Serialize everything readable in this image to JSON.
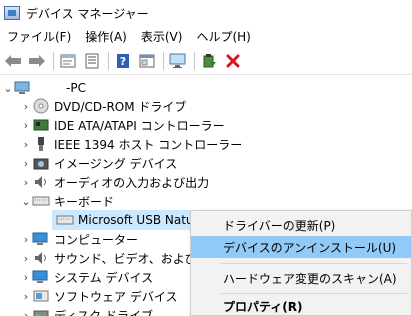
{
  "window": {
    "title": "デバイス マネージャー"
  },
  "menubar": {
    "items": [
      {
        "label": "ファイル(F)"
      },
      {
        "label": "操作(A)"
      },
      {
        "label": "表示(V)"
      },
      {
        "label": "ヘルプ(H)"
      }
    ]
  },
  "toolbar": {
    "icons": [
      "back-arrow-icon",
      "forward-arrow-icon",
      "properties-sheet-icon",
      "view-list-icon",
      "help-icon",
      "panel-icon",
      "monitor-scan-icon",
      "update-driver-icon",
      "uninstall-x-icon"
    ]
  },
  "tree": {
    "root": {
      "label": "-PC"
    },
    "items": [
      {
        "label": "DVD/CD-ROM ドライブ",
        "icon": "dvd-drive-icon",
        "expanded": false
      },
      {
        "label": "IDE ATA/ATAPI コントローラー",
        "icon": "ide-controller-icon",
        "expanded": false
      },
      {
        "label": "IEEE 1394 ホスト コントローラー",
        "icon": "ieee1394-controller-icon",
        "expanded": false
      },
      {
        "label": "イメージング デバイス",
        "icon": "camera-icon",
        "expanded": false
      },
      {
        "label": "オーディオの入力および出力",
        "icon": "speaker-icon",
        "expanded": false
      },
      {
        "label": "キーボード",
        "icon": "keyboard-icon",
        "expanded": true
      },
      {
        "label": "Microsoft USB Natural",
        "icon": "keyboard-icon",
        "child": true,
        "selected": true
      },
      {
        "label": "コンピューター",
        "icon": "computer-icon",
        "expanded": false
      },
      {
        "label": "サウンド、ビデオ、およびゲーム",
        "icon": "sound-icon",
        "expanded": false
      },
      {
        "label": "システム デバイス",
        "icon": "system-device-icon",
        "expanded": false
      },
      {
        "label": "ソフトウェア デバイス",
        "icon": "software-device-icon",
        "expanded": false
      },
      {
        "label": "ディスク ドライブ",
        "icon": "disk-drive-icon",
        "expanded": false
      }
    ]
  },
  "context_menu": {
    "items": [
      {
        "label": "ドライバーの更新(P)"
      },
      {
        "label": "デバイスのアンインストール(U)",
        "highlighted": true
      },
      {
        "label": "ハードウェア変更のスキャン(A)"
      },
      {
        "label": "プロパティ(R)",
        "bold": true
      }
    ]
  },
  "colors": {
    "selection": "#cce8ff",
    "menu_highlight": "#91c9f7",
    "uninstall_red": "#d9141c"
  }
}
